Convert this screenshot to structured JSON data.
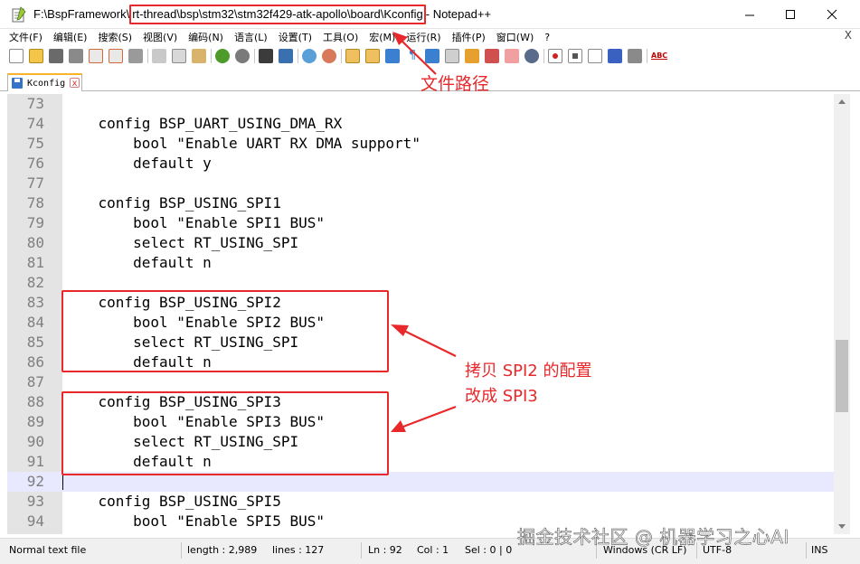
{
  "window": {
    "title_prefix": "F:\\BspFramework\\",
    "title_path": "rt-thread\\bsp\\stm32\\stm32f429-atk-apollo\\board\\Kconfig",
    "title_suffix": " - Notepad++"
  },
  "menu": {
    "items": [
      "文件(F)",
      "编辑(E)",
      "搜索(S)",
      "视图(V)",
      "编码(N)",
      "语言(L)",
      "设置(T)",
      "工具(O)",
      "宏(M)",
      "运行(R)",
      "插件(P)",
      "窗口(W)",
      "?"
    ],
    "close_glyph": "X"
  },
  "toolbar": {
    "spell_label": "ABC"
  },
  "tab": {
    "label": "Kconfig",
    "close_glyph": "x"
  },
  "editor": {
    "lines": [
      {
        "n": "73",
        "text": ""
      },
      {
        "n": "74",
        "text": "    config BSP_UART_USING_DMA_RX"
      },
      {
        "n": "75",
        "text": "        bool \"Enable UART RX DMA support\""
      },
      {
        "n": "76",
        "text": "        default y"
      },
      {
        "n": "77",
        "text": ""
      },
      {
        "n": "78",
        "text": "    config BSP_USING_SPI1"
      },
      {
        "n": "79",
        "text": "        bool \"Enable SPI1 BUS\""
      },
      {
        "n": "80",
        "text": "        select RT_USING_SPI"
      },
      {
        "n": "81",
        "text": "        default n"
      },
      {
        "n": "82",
        "text": ""
      },
      {
        "n": "83",
        "text": "    config BSP_USING_SPI2"
      },
      {
        "n": "84",
        "text": "        bool \"Enable SPI2 BUS\""
      },
      {
        "n": "85",
        "text": "        select RT_USING_SPI"
      },
      {
        "n": "86",
        "text": "        default n"
      },
      {
        "n": "87",
        "text": ""
      },
      {
        "n": "88",
        "text": "    config BSP_USING_SPI3"
      },
      {
        "n": "89",
        "text": "        bool \"Enable SPI3 BUS\""
      },
      {
        "n": "90",
        "text": "        select RT_USING_SPI"
      },
      {
        "n": "91",
        "text": "        default n"
      },
      {
        "n": "92",
        "text": ""
      },
      {
        "n": "93",
        "text": "    config BSP_USING_SPI5"
      },
      {
        "n": "94",
        "text": "        bool \"Enable SPI5 BUS\""
      }
    ],
    "current_line": "92"
  },
  "statusbar": {
    "file_type": "Normal text file",
    "length": "length : 2,989",
    "lines": "lines : 127",
    "ln": "Ln : 92",
    "col": "Col : 1",
    "sel": "Sel : 0 | 0",
    "eol": "Windows (CR LF)",
    "encoding": "UTF-8",
    "mode": "INS"
  },
  "annotations": {
    "path_label": "文件路径",
    "note_line1": "拷贝 SPI2 的配置",
    "note_line2": "改成 SPI3",
    "color": "#e8282b"
  },
  "watermark": "掘金技术社区 @ 机器学习之心AI"
}
